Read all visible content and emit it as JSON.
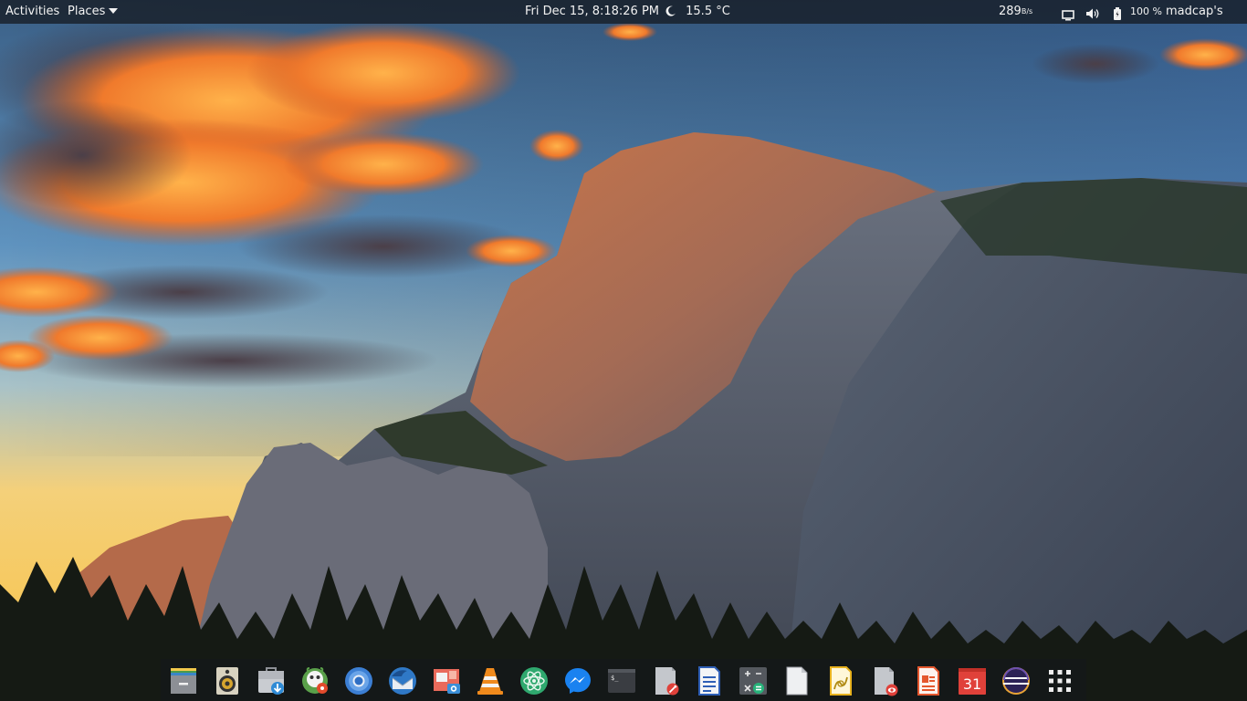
{
  "topbar": {
    "activities_label": "Activities",
    "places_label": "Places",
    "datetime": "Fri Dec 15,  8:18:26 PM",
    "weather": {
      "icon": "moon-icon",
      "temperature": "15.5 °C"
    },
    "net_speed_value": "289",
    "net_speed_unit": "B/s",
    "battery_percent": "100 %",
    "user_name": "madcap's"
  },
  "dock": {
    "apps": [
      {
        "name": "Files",
        "icon": "file-manager-icon"
      },
      {
        "name": "Rhythmbox",
        "icon": "speaker-icon"
      },
      {
        "name": "Software",
        "icon": "software-install-icon"
      },
      {
        "name": "GIMP",
        "icon": "gimp-icon"
      },
      {
        "name": "Chromium",
        "icon": "chromium-icon"
      },
      {
        "name": "Thunderbird",
        "icon": "thunderbird-icon"
      },
      {
        "name": "Screenshot",
        "icon": "screenshot-icon"
      },
      {
        "name": "VLC",
        "icon": "vlc-icon"
      },
      {
        "name": "Atom",
        "icon": "atom-icon"
      },
      {
        "name": "Messenger",
        "icon": "messenger-icon"
      },
      {
        "name": "Terminal",
        "icon": "terminal-icon"
      },
      {
        "name": "Text Editor",
        "icon": "text-editor-icon"
      },
      {
        "name": "Document Writer",
        "icon": "document-writer-icon"
      },
      {
        "name": "Calculator",
        "icon": "calculator-icon"
      },
      {
        "name": "Blank Document",
        "icon": "blank-document-icon"
      },
      {
        "name": "Draw",
        "icon": "draw-icon"
      },
      {
        "name": "Document Viewer",
        "icon": "document-viewer-icon"
      },
      {
        "name": "Presentation",
        "icon": "presentation-icon"
      },
      {
        "name": "Calendar",
        "icon": "calendar-icon",
        "label": "31"
      },
      {
        "name": "Eclipse",
        "icon": "eclipse-icon"
      },
      {
        "name": "Show Applications",
        "icon": "app-grid-icon"
      }
    ]
  }
}
